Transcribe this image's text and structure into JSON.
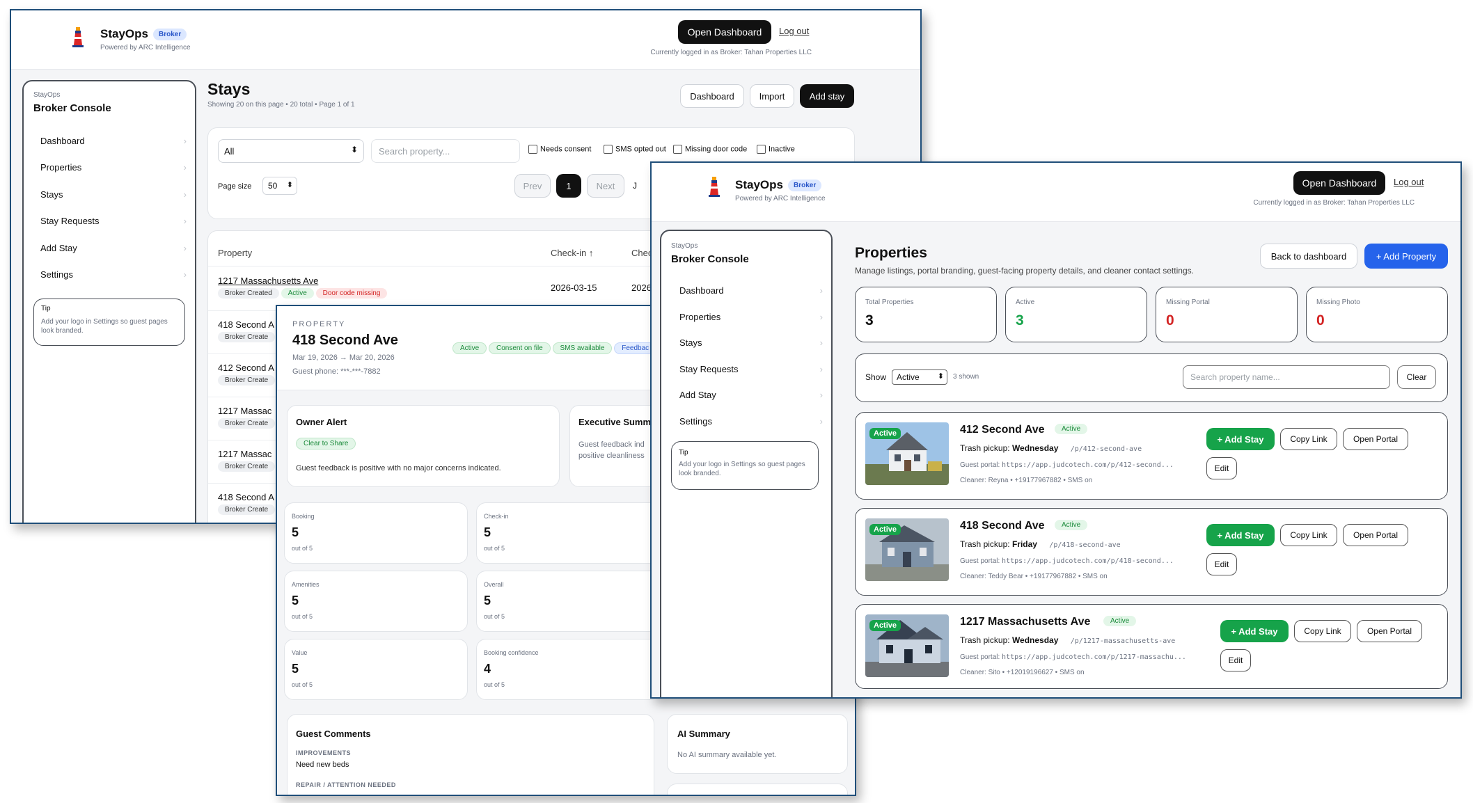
{
  "brand": {
    "name": "StayOps",
    "badge": "Broker",
    "powered_by": "Powered by ARC Intelligence"
  },
  "header": {
    "open_dashboard": "Open Dashboard",
    "logout": "Log out",
    "logged_in_as": "Currently logged in as Broker: Tahan Properties LLC"
  },
  "sidebar": {
    "app": "StayOps",
    "title": "Broker Console",
    "items": [
      "Dashboard",
      "Properties",
      "Stays",
      "Stay Requests",
      "Add Stay",
      "Settings"
    ],
    "tip_title": "Tip",
    "tip_text": "Add your logo in Settings so guest pages look branded."
  },
  "stays": {
    "title": "Stays",
    "subtitle": "Showing 20 on this page • 20 total • Page 1 of 1",
    "btn_dashboard": "Dashboard",
    "btn_import": "Import",
    "btn_add": "Add stay",
    "filter_select": "All",
    "search_placeholder": "Search property...",
    "checkboxes": [
      "Needs consent",
      "SMS opted out",
      "Missing door code",
      "Inactive"
    ],
    "page_size_label": "Page size",
    "page_size": "50",
    "prev": "Prev",
    "page": "1",
    "next": "Next",
    "jump": "J",
    "col_property": "Property",
    "col_checkin": "Check-in ↑",
    "col_checkout": "Chec",
    "rows": [
      {
        "property": "1217 Massachusetts Ave",
        "status": "Broker Created",
        "active": "Active",
        "alert": "Door code missing",
        "checkin": "2026-03-15",
        "checkout": "2026"
      },
      {
        "property": "418 Second A",
        "status": "Broker Create"
      },
      {
        "property": "412 Second A",
        "status": "Broker Create"
      },
      {
        "property": "1217 Massac",
        "status": "Broker Create"
      },
      {
        "property": "1217 Massac",
        "status": "Broker Create"
      },
      {
        "property": "418 Second A",
        "status": "Broker Create"
      }
    ]
  },
  "stay_detail": {
    "eyebrow": "PROPERTY",
    "title": "418 Second Ave",
    "dates": "Mar 19, 2026 → Mar 20, 2026",
    "phone": "Guest phone: ***-***-7882",
    "pills": [
      "Active",
      "Consent on file",
      "SMS available",
      "Feedbac"
    ],
    "owner_alert_title": "Owner Alert",
    "owner_alert_pill": "Clear to Share",
    "owner_alert_text": "Guest feedback is positive with no major concerns indicated.",
    "exec_title": "Executive Summ",
    "exec_text_1": "Guest feedback ind",
    "exec_text_2": "positive cleanliness",
    "scores": [
      {
        "label": "Booking",
        "value": "5",
        "sub": "out of 5"
      },
      {
        "label": "Check-in",
        "value": "5",
        "sub": "out of 5"
      },
      {
        "label": "Amenities",
        "value": "5",
        "sub": "out of 5"
      },
      {
        "label": "Overall",
        "value": "5",
        "sub": "out of 5"
      },
      {
        "label": "Value",
        "value": "5",
        "sub": "out of 5"
      },
      {
        "label": "Booking confidence",
        "value": "4",
        "sub": "out of 5"
      }
    ],
    "comments_title": "Guest Comments",
    "improvements_label": "IMPROVEMENTS",
    "improvements_text": "Need new beds",
    "repair_label": "REPAIR / ATTENTION NEEDED",
    "ai_title": "AI Summary",
    "ai_text": "No AI summary available yet."
  },
  "properties": {
    "title": "Properties",
    "subtitle": "Manage listings, portal branding, guest-facing property details, and cleaner contact settings.",
    "back": "Back to dashboard",
    "add": "+ Add Property",
    "stats": [
      {
        "label": "Total Properties",
        "value": "3",
        "color": "#111111"
      },
      {
        "label": "Active",
        "value": "3",
        "color": "#16a34a"
      },
      {
        "label": "Missing Portal",
        "value": "0",
        "color": "#d32323"
      },
      {
        "label": "Missing Photo",
        "value": "0",
        "color": "#d32323"
      }
    ],
    "show_label": "Show",
    "show_value": "Active",
    "shown": "3 shown",
    "search_placeholder": "Search property name...",
    "clear": "Clear",
    "list": [
      {
        "name": "412 Second Ave",
        "status": "Active",
        "photo_badge": "Active",
        "trash_label": "Trash pickup:",
        "trash_day": "Wednesday",
        "path": "/p/412-second-ave",
        "portal_label": "Guest portal:",
        "portal_url": "https://app.judcotech.com/p/412-second...",
        "cleaner": "Cleaner: Reyna • +19177967882 • SMS on",
        "add_stay": "+ Add Stay",
        "copy": "Copy Link",
        "open": "Open Portal",
        "edit": "Edit"
      },
      {
        "name": "418 Second Ave",
        "status": "Active",
        "photo_badge": "Active",
        "trash_label": "Trash pickup:",
        "trash_day": "Friday",
        "path": "/p/418-second-ave",
        "portal_label": "Guest portal:",
        "portal_url": "https://app.judcotech.com/p/418-second...",
        "cleaner": "Cleaner: Teddy Bear • +19177967882 • SMS on",
        "add_stay": "+ Add Stay",
        "copy": "Copy Link",
        "open": "Open Portal",
        "edit": "Edit"
      },
      {
        "name": "1217 Massachusetts Ave",
        "status": "Active",
        "photo_badge": "Active",
        "trash_label": "Trash pickup:",
        "trash_day": "Wednesday",
        "path": "/p/1217-massachusetts-ave",
        "portal_label": "Guest portal:",
        "portal_url": "https://app.judcotech.com/p/1217-massachu...",
        "cleaner": "Cleaner: Sito • +12019196627 • SMS on",
        "add_stay": "+ Add Stay",
        "copy": "Copy Link",
        "open": "Open Portal",
        "edit": "Edit"
      }
    ]
  }
}
